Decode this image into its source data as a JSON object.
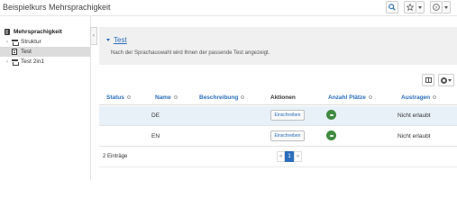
{
  "header": {
    "title": "Beispielkurs Mehrsprachigkeit",
    "icons": [
      "search-icon",
      "star-icon",
      "help-icon"
    ]
  },
  "tree": {
    "root": "Mehrsprachigkeit",
    "items": [
      {
        "label": "Struktur",
        "icon": "structure-icon",
        "selected": false
      },
      {
        "label": "Test",
        "icon": "test-icon",
        "selected": true
      },
      {
        "label": "Test 2in1",
        "icon": "structure-icon",
        "selected": false
      }
    ]
  },
  "panel": {
    "title": "Test",
    "description": "Nach der Sprachauswahl wird Ihnen der passende Test angezeigt."
  },
  "table": {
    "columns": [
      "Status",
      "Name",
      "Beschreibung",
      "Aktionen",
      "Anzahl Plätze",
      "Austragen"
    ],
    "rows": [
      {
        "status": "",
        "name": "DE",
        "beschreibung": "",
        "aktion": "Einschreiben",
        "austragen": "Nicht erlaubt"
      },
      {
        "status": "",
        "name": "EN",
        "beschreibung": "",
        "aktion": "Einschreiben",
        "austragen": "Nicht erlaubt"
      }
    ],
    "entries": "2 Einträge",
    "pager": {
      "prev": "«",
      "current": "1",
      "next": "»"
    }
  },
  "colors": {
    "accent": "#2a6ebb",
    "badge": "#3f8a3f",
    "row_highlight": "#e8f0f8"
  }
}
